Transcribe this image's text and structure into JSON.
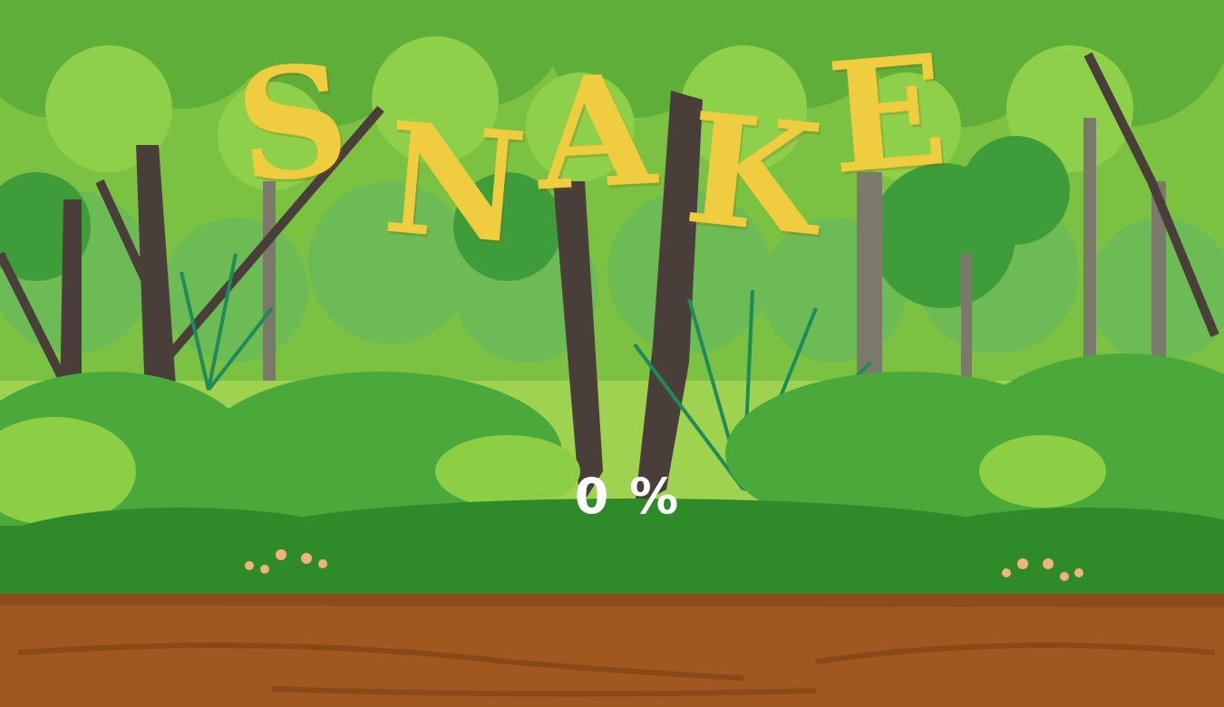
{
  "game": {
    "title_letters": [
      "S",
      "N",
      "A",
      "K",
      "E"
    ],
    "loading_percent": "0 %",
    "loading_value": 0
  },
  "colors": {
    "title": "#f0cd3e",
    "percent": "#ffffff",
    "ground": "#a0581f",
    "foliage_light": "#8ccf45",
    "foliage_dark": "#2f8a2a"
  }
}
